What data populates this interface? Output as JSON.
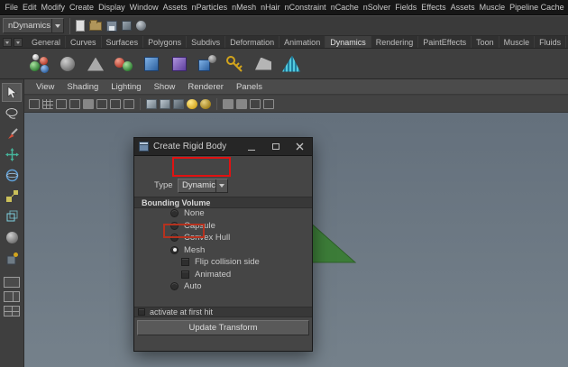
{
  "menubar": {
    "items": [
      "File",
      "Edit",
      "Modify",
      "Create",
      "Display",
      "Window",
      "Assets",
      "nParticles",
      "nMesh",
      "nHair",
      "nConstraint",
      "nCache",
      "nSolver",
      "Fields",
      "Effects",
      "Assets",
      "Muscle",
      "Pipeline Cache"
    ]
  },
  "statusline": {
    "menuset_label": "nDynamics",
    "icons": [
      "new-scene",
      "open-scene",
      "save-scene",
      "selection-cube",
      "selection-sphere"
    ]
  },
  "shelf": {
    "tabs": [
      "General",
      "Curves",
      "Surfaces",
      "Polygons",
      "Subdivs",
      "Deformation",
      "Animation",
      "Dynamics",
      "Rendering",
      "PaintEffects",
      "Toon",
      "Muscle",
      "Fluids"
    ],
    "active_tab": "Dynamics",
    "icons": [
      "colored-spheres",
      "gray-sphere",
      "soft-wedge",
      "two-spheres",
      "blue-cube",
      "purple-cube",
      "cube-with-sphere",
      "gold-key",
      "gray-prism",
      "striped-logo"
    ]
  },
  "toolbox": {
    "icons": [
      "select-tool",
      "lasso-tool",
      "paint-select-tool",
      "move-tool",
      "rotate-tool",
      "scale-tool",
      "universal-manipulator",
      "soft-mod-tool",
      "show-manipulator"
    ],
    "layouts": [
      "single-pane-layout",
      "two-pane-layout",
      "four-pane-layout"
    ]
  },
  "panel": {
    "menus": [
      "View",
      "Shading",
      "Lighting",
      "Show",
      "Renderer",
      "Panels"
    ],
    "toolbar_icons": [
      "select-camera",
      "grid",
      "film-gate",
      "resolution-gate",
      "gate-mask",
      "field-chart",
      "safe-action",
      "safe-title",
      "wireframe",
      "shaded",
      "textured",
      "lights",
      "shadows",
      "ssao",
      "motion-blur",
      "xray",
      "isolate-select"
    ]
  },
  "dialog": {
    "title": "Create Rigid Body",
    "window_controls": [
      "minimize",
      "maximize",
      "close"
    ],
    "type_label": "Type",
    "type_value": "Dynamic",
    "section": "Bounding Volume",
    "options": [
      {
        "label": "None",
        "selected": false
      },
      {
        "label": "Capsule",
        "selected": false
      },
      {
        "label": "Convex Hull",
        "selected": false
      },
      {
        "label": "Mesh",
        "selected": true
      },
      {
        "label": "Auto",
        "selected": false
      }
    ],
    "sub_checkboxes": [
      {
        "label": "Flip collision side",
        "checked": false
      },
      {
        "label": "Animated",
        "checked": false
      }
    ],
    "footer_checkbox": {
      "label": "activate at first hit",
      "checked": false
    },
    "update_button": "Update Transform"
  },
  "annotations": [
    {
      "target": "type-dropdown",
      "color": "#e01212"
    },
    {
      "target": "mesh-radio",
      "color": "#b5321f"
    }
  ],
  "colors": {
    "viewport_top": "#64707c",
    "viewport_bottom": "#75818b",
    "dialog_bg": "#454545",
    "titlebar_bg": "#262626",
    "scene_object_green": "#3c7c38"
  }
}
